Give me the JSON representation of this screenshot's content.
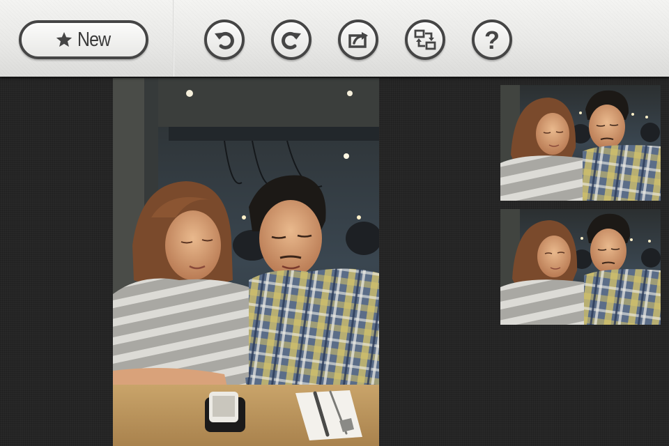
{
  "toolbar": {
    "new_button": {
      "label": "New",
      "icon": "star-icon"
    },
    "tools": [
      {
        "name": "undo",
        "icon": "undo-arrow-icon"
      },
      {
        "name": "redo",
        "icon": "redo-arrow-icon"
      },
      {
        "name": "share",
        "icon": "share-box-icon"
      },
      {
        "name": "swap",
        "icon": "swap-frames-icon"
      },
      {
        "name": "help",
        "icon": "question-mark-icon",
        "glyph": "?"
      }
    ]
  },
  "canvas": {
    "main_photo": {
      "subject": "couple-at-restaurant"
    },
    "thumbnails": [
      {
        "subject": "couple-at-restaurant"
      },
      {
        "subject": "couple-at-restaurant"
      }
    ]
  },
  "colors": {
    "toolbar_bg": "#ececea",
    "button_border": "#454545",
    "canvas_bg": "#252525"
  }
}
